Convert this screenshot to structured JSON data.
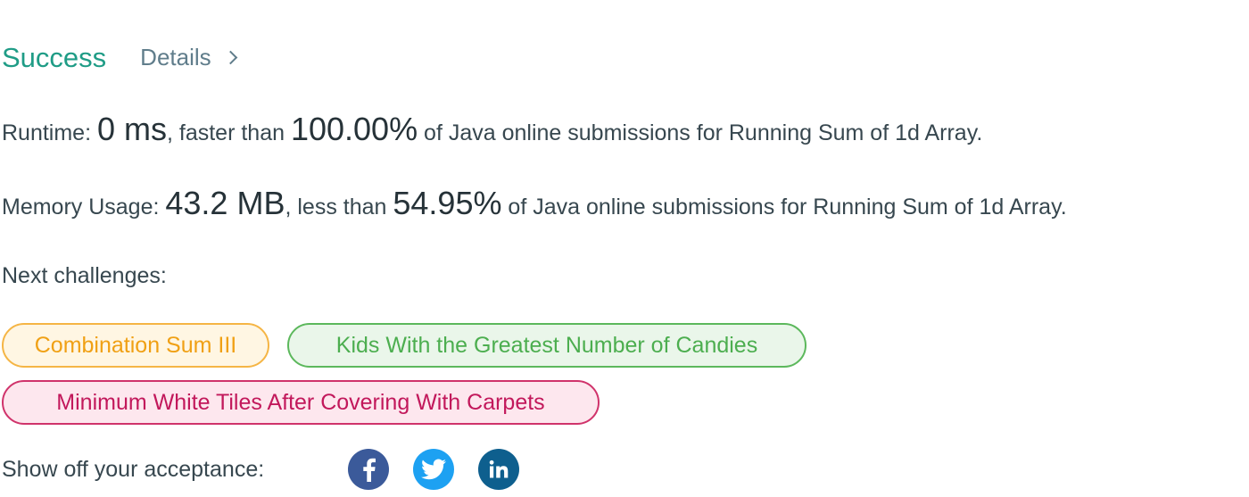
{
  "status": {
    "label": "Success",
    "details_label": "Details"
  },
  "runtime": {
    "prefix": "Runtime: ",
    "value": "0 ms",
    "middle": ", faster than ",
    "percent": "100.00%",
    "suffix": " of Java online submissions for Running Sum of 1d Array."
  },
  "memory": {
    "prefix": "Memory Usage: ",
    "value": "43.2 MB",
    "middle": ", less than ",
    "percent": "54.95%",
    "suffix": " of Java online submissions for Running Sum of 1d Array."
  },
  "next_challenges": {
    "label": "Next challenges:",
    "items": [
      {
        "label": "Combination Sum III",
        "difficulty_color": "#f0a014"
      },
      {
        "label": "Kids With the Greatest Number of Candies",
        "difficulty_color": "#4cae4f"
      },
      {
        "label": "Minimum White Tiles After Covering With Carpets",
        "difficulty_color": "#c2185b"
      }
    ]
  },
  "share": {
    "label": "Show off your acceptance:",
    "icons": [
      {
        "name": "facebook-icon",
        "color": "#3b5a9a"
      },
      {
        "name": "twitter-icon",
        "color": "#1da1f2"
      },
      {
        "name": "linkedin-icon",
        "color": "#0e5f8e"
      }
    ]
  },
  "colors": {
    "success": "#1f9c86",
    "details": "#607d8b",
    "text": "#37474f"
  }
}
